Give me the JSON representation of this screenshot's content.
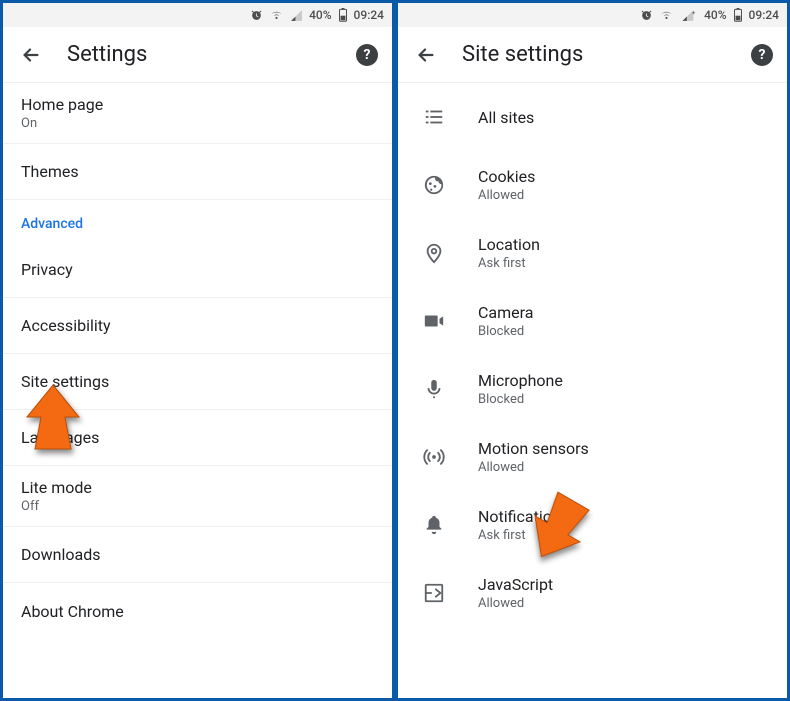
{
  "status": {
    "battery_pct": "40%",
    "time": "09:24"
  },
  "left": {
    "title": "Settings",
    "items": [
      {
        "title": "Home page",
        "sub": "On"
      },
      {
        "title": "Themes",
        "sub": null
      }
    ],
    "section_label": "Advanced",
    "adv_items": [
      {
        "title": "Privacy",
        "sub": null
      },
      {
        "title": "Accessibility",
        "sub": null
      },
      {
        "title": "Site settings",
        "sub": null
      },
      {
        "title": "Languages",
        "sub": null
      },
      {
        "title": "Lite mode",
        "sub": "Off"
      },
      {
        "title": "Downloads",
        "sub": null
      },
      {
        "title": "About Chrome",
        "sub": null
      }
    ]
  },
  "right": {
    "title": "Site settings",
    "items": [
      {
        "icon": "list",
        "title": "All sites",
        "sub": null
      },
      {
        "icon": "cookie",
        "title": "Cookies",
        "sub": "Allowed"
      },
      {
        "icon": "location",
        "title": "Location",
        "sub": "Ask first"
      },
      {
        "icon": "camera",
        "title": "Camera",
        "sub": "Blocked"
      },
      {
        "icon": "mic",
        "title": "Microphone",
        "sub": "Blocked"
      },
      {
        "icon": "sensors",
        "title": "Motion sensors",
        "sub": "Allowed"
      },
      {
        "icon": "bell",
        "title": "Notifications",
        "sub": "Ask first"
      },
      {
        "icon": "javascript",
        "title": "JavaScript",
        "sub": "Allowed"
      }
    ]
  },
  "annotations": {
    "arrow_color": "#f36a12"
  }
}
